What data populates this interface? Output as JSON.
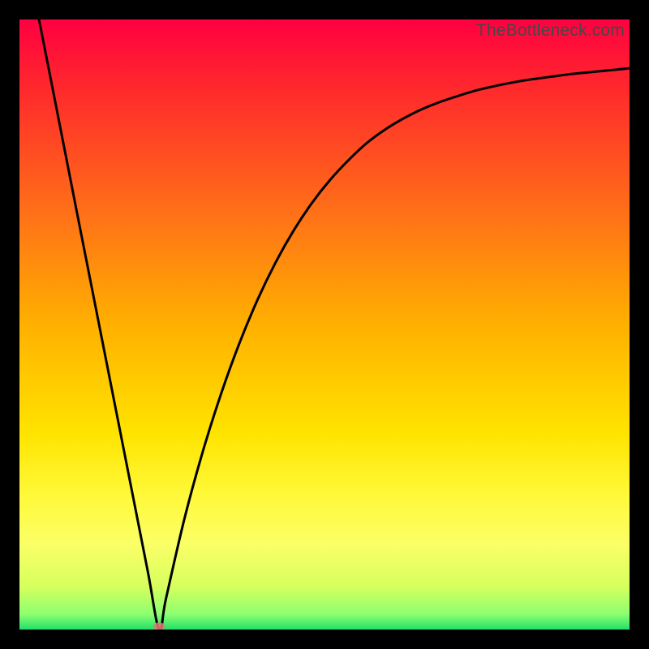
{
  "watermark": "TheBottleneck.com",
  "chart_data": {
    "type": "line",
    "title": "",
    "xlabel": "",
    "ylabel": "",
    "xlim": [
      0,
      100
    ],
    "ylim": [
      0,
      100
    ],
    "x": [
      3.2,
      6,
      9,
      12,
      15,
      18,
      21,
      22.9,
      24,
      27,
      30,
      33,
      36,
      39,
      42,
      45,
      48,
      51,
      54,
      57,
      60,
      63,
      66,
      69,
      72,
      75,
      78,
      81,
      84,
      87,
      90,
      93,
      96,
      100
    ],
    "values": [
      100,
      85.8,
      70.5,
      55.3,
      40.1,
      24.9,
      9.7,
      0.0,
      5.0,
      18.0,
      29.0,
      38.5,
      46.8,
      54.0,
      60.2,
      65.5,
      70.0,
      73.8,
      77.0,
      79.8,
      82.0,
      83.8,
      85.3,
      86.5,
      87.5,
      88.4,
      89.1,
      89.7,
      90.2,
      90.6,
      91.0,
      91.3,
      91.6,
      92.0
    ],
    "marker": {
      "x": 22.9,
      "y": 0.5
    },
    "gradient_stops": [
      {
        "offset": 0.0,
        "color": "#ff0040"
      },
      {
        "offset": 0.12,
        "color": "#ff2b2b"
      },
      {
        "offset": 0.3,
        "color": "#ff6a1a"
      },
      {
        "offset": 0.5,
        "color": "#ffb000"
      },
      {
        "offset": 0.68,
        "color": "#ffe400"
      },
      {
        "offset": 0.78,
        "color": "#fff93a"
      },
      {
        "offset": 0.86,
        "color": "#fbff66"
      },
      {
        "offset": 0.93,
        "color": "#d6ff5e"
      },
      {
        "offset": 0.975,
        "color": "#8cff70"
      },
      {
        "offset": 1.0,
        "color": "#22e06a"
      }
    ]
  }
}
